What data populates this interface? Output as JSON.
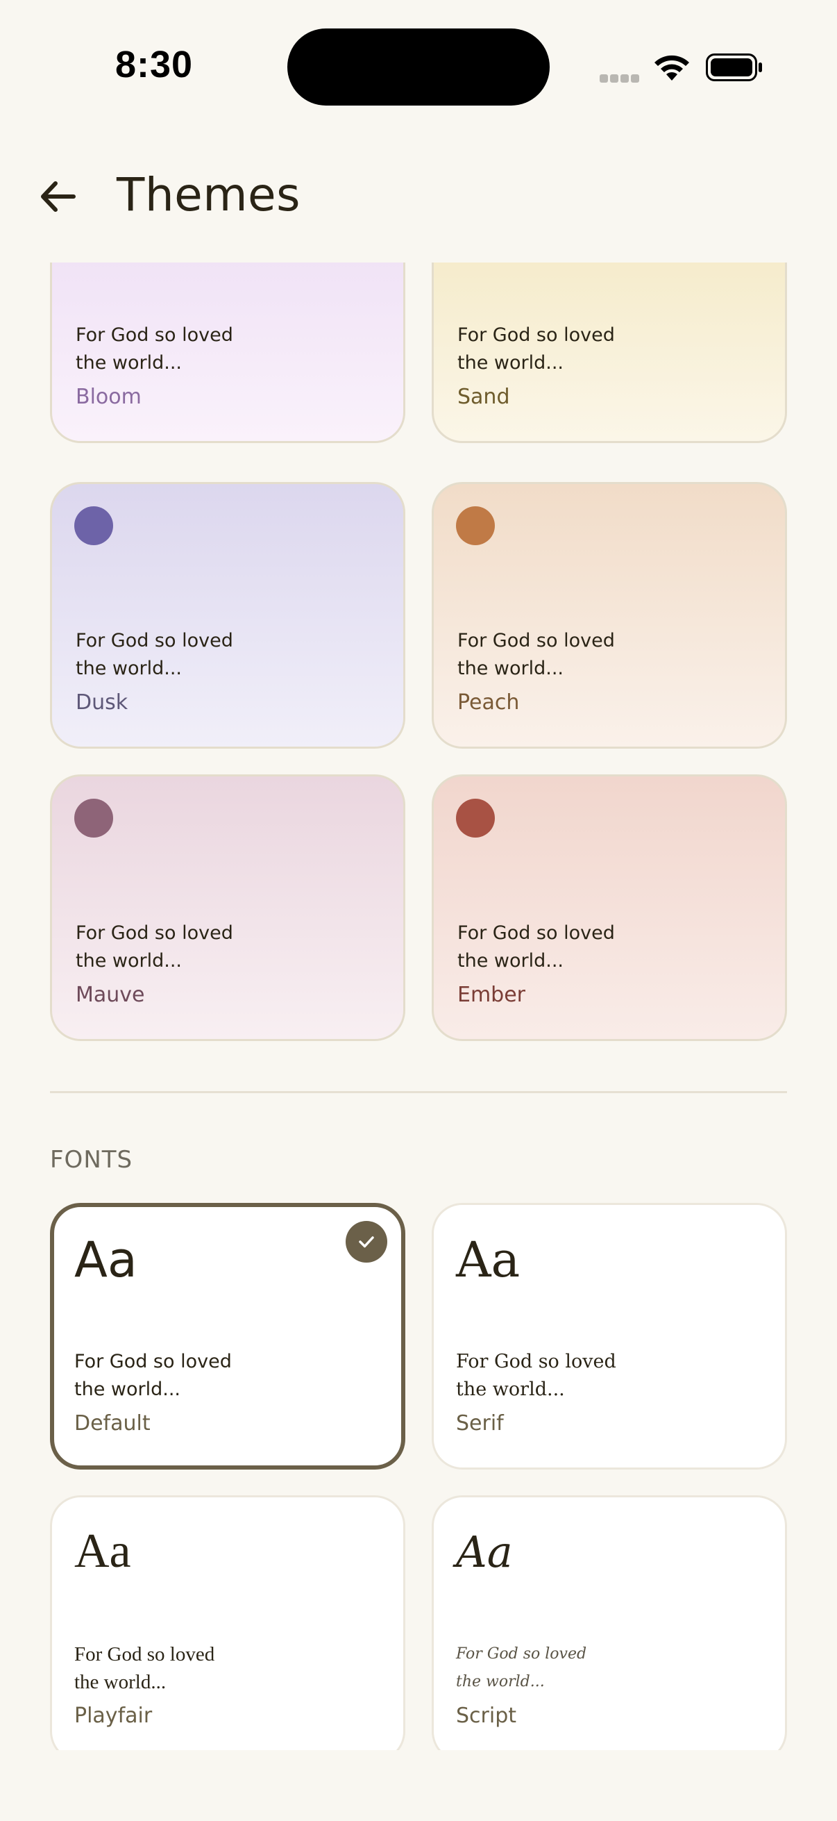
{
  "status": {
    "time": "8:30"
  },
  "header": {
    "title": "Themes"
  },
  "themes": [
    {
      "name": "Bloom",
      "verse_l1": "For God so loved",
      "verse_l2": "the world...",
      "name_color": "#8a6aa0",
      "bg_top": "#ecdcf4",
      "bg_bottom": "#faf2fb",
      "dot": ""
    },
    {
      "name": "Sand",
      "verse_l1": "For God so loved",
      "verse_l2": "the world...",
      "name_color": "#6e5c2c",
      "bg_top": "#f3e7bf",
      "bg_bottom": "#fbf6e8",
      "dot": ""
    },
    {
      "name": "Dusk",
      "verse_l1": "For God so loved",
      "verse_l2": "the world...",
      "name_color": "#5e5878",
      "bg_top": "#dcd7ee",
      "bg_bottom": "#f1eff9",
      "dot": "#6d63a8"
    },
    {
      "name": "Peach",
      "verse_l1": "For God so loved",
      "verse_l2": "the world...",
      "name_color": "#7a5a36",
      "bg_top": "#f1dcc8",
      "bg_bottom": "#faf1ea",
      "dot": "#c07a46"
    },
    {
      "name": "Mauve",
      "verse_l1": "For God so loved",
      "verse_l2": "the world...",
      "name_color": "#6e4a5a",
      "bg_top": "#ead6df",
      "bg_bottom": "#f8eff2",
      "dot": "#8e6478"
    },
    {
      "name": "Ember",
      "verse_l1": "For God so loved",
      "verse_l2": "the world...",
      "name_color": "#7a3d36",
      "bg_top": "#f1d6cd",
      "bg_bottom": "#f9ece8",
      "dot": "#a85244"
    }
  ],
  "fonts_section": {
    "label": "FONTS"
  },
  "fonts": [
    {
      "name": "Default",
      "sample": "Aa",
      "verse_l1": "For God so loved",
      "verse_l2": "the world...",
      "selected": true
    },
    {
      "name": "Serif",
      "sample": "Aa",
      "verse_l1": "For God so loved",
      "verse_l2": "the world...",
      "selected": false
    },
    {
      "name": "Playfair",
      "sample": "Aa",
      "verse_l1": "For God so loved",
      "verse_l2": "the world...",
      "selected": false
    },
    {
      "name": "Script",
      "sample": "Aa",
      "verse_l1": "For God so loved",
      "verse_l2": "the world...",
      "selected": false
    }
  ],
  "colors": {
    "background": "#f9f7f1",
    "accent": "#6b6049",
    "text": "#2a2416"
  },
  "icons": {
    "back": "arrow-left-icon",
    "check": "check-icon",
    "wifi": "wifi-icon",
    "battery": "battery-icon"
  }
}
